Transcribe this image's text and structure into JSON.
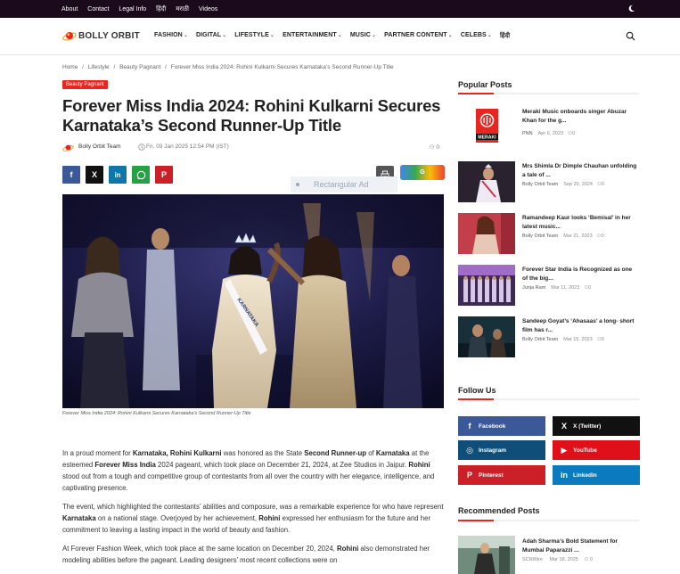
{
  "topbar": {
    "links": [
      "About",
      "Contact",
      "Legal Info",
      "हिंदी",
      "मराठी",
      "Videos"
    ],
    "dark_mode_icon": "moon-icon"
  },
  "header": {
    "logo_text": "BOLLY ORBIT",
    "nav": [
      {
        "label": "FASHION",
        "dropdown": true
      },
      {
        "label": "DIGITAL",
        "dropdown": true
      },
      {
        "label": "LIFESTYLE",
        "dropdown": true
      },
      {
        "label": "ENTERTAINMENT",
        "dropdown": true
      },
      {
        "label": "MUSIC",
        "dropdown": true
      },
      {
        "label": "PARTNER CONTENT",
        "dropdown": true
      },
      {
        "label": "CELEBS",
        "dropdown": true
      },
      {
        "label": "हिंदी",
        "dropdown": false
      }
    ],
    "search_icon": "search-icon"
  },
  "breadcrumb": [
    "Home",
    "/",
    "Lifestyle",
    "/",
    "Beauty Pagnant",
    "/",
    "Forever Miss India 2024: Rohini Kulkarni Secures Karnataka’s Second Runner-Up Title"
  ],
  "article": {
    "category": "Beauty Pagnant",
    "title": "Forever Miss India 2024: Rohini Kulkarni Secures Karnataka’s Second Runner-Up Title",
    "author": "Bolly Orbit Team",
    "date": "Fri, 03 Jan 2025 12:54 PM (IST)",
    "comments": "0",
    "ad_label": "Rectangular Ad",
    "google_badge": "G",
    "caption": "Forever Miss India 2024: Rohini Kulkarni Secures Karnataka's Second Runner-Up Title",
    "paragraphs": [
      [
        {
          "t": "In a proud moment for "
        },
        {
          "t": "Karnataka, Rohini Kulkarni",
          "b": true
        },
        {
          "t": " was honored as the State "
        },
        {
          "t": "Second Runner-up",
          "b": true
        },
        {
          "t": " of "
        },
        {
          "t": "Karnataka",
          "b": true
        },
        {
          "t": " at the esteemed "
        },
        {
          "t": "Forever Miss India",
          "b": true
        },
        {
          "t": " 2024 pageant, which took place on December 21, 2024, at Zee Studios in Jaipur. "
        },
        {
          "t": "Rohini",
          "b": true
        },
        {
          "t": " stood out from a tough and competitive group of contestants from all over the country with her elegance, intelligence, and captivating presence."
        }
      ],
      [
        {
          "t": "The event, which highlighted the contestants’ abilities and composure, was a remarkable experience for who have represent "
        },
        {
          "t": "Karnataka",
          "b": true
        },
        {
          "t": " on a national stage. Overjoyed by her achievement, "
        },
        {
          "t": "Rohini",
          "b": true
        },
        {
          "t": " expressed her enthusiasm for the future and her commitment to leaving a lasting impact in the world of beauty and fashion."
        }
      ],
      [
        {
          "t": "At Forever Fashion Week, which took place at the same location on December 20, 2024, "
        },
        {
          "t": "Rohini",
          "b": true
        },
        {
          "t": " also demonstrated her modeling abilities before the pageant. Leading designers’ most recent collections were on"
        }
      ]
    ]
  },
  "sidebar": {
    "popular_heading": "Popular Posts",
    "popular": [
      {
        "title": "Meraki Music onboards singer Abuzar Khan for the g...",
        "author": "PNN",
        "date": "Apr 6, 2023",
        "comments": "0",
        "thumb": "meraki"
      },
      {
        "title": "Mrs Shimla Dr Dimple Chauhan unfolding a tale of ...",
        "author": "Bolly Orbit Team",
        "date": "Sep 20, 2024",
        "comments": "0",
        "thumb": "shimla"
      },
      {
        "title": "Ramandeep Kaur looks ‘Bemisal’ in her latest music...",
        "author": "Bolly Orbit Team",
        "date": "Mar 21, 2023",
        "comments": "0",
        "thumb": "ramandeep"
      },
      {
        "title": "Forever Star India is Recognized as one of the big...",
        "author": "Junja Ram",
        "date": "Mar 11, 2023",
        "comments": "0",
        "thumb": "forever"
      },
      {
        "title": "Sandeep Goyat’s ‘Ahasaas’ a long- short film has r...",
        "author": "Bolly Orbit Team",
        "date": "Mar 15, 2023",
        "comments": "0",
        "thumb": "sandeep"
      }
    ],
    "meraki_logo_text": "MERAKI",
    "follow_heading": "Follow Us",
    "follow": [
      {
        "label": "Facebook",
        "icon": "facebook-icon",
        "glyph": "f",
        "color": "#3b5998"
      },
      {
        "label": "X (Twitter)",
        "icon": "x-icon",
        "glyph": "X",
        "color": "#111111"
      },
      {
        "label": "Instagram",
        "icon": "instagram-icon",
        "glyph": "◎",
        "color": "#0e4e78"
      },
      {
        "label": "YouTube",
        "icon": "youtube-icon",
        "glyph": "▶",
        "color": "#e0101a"
      },
      {
        "label": "Pinterest",
        "icon": "pinterest-icon",
        "glyph": "P",
        "color": "#cb2027"
      },
      {
        "label": "Linkedin",
        "icon": "linkedin-icon",
        "glyph": "in",
        "color": "#0a7bbf"
      }
    ],
    "recommended_heading": "Recommended Posts",
    "recommended": [
      {
        "title": "Adah Sharma’s Bold Statement for Mumbai Paparazzi ...",
        "author": "SCNWire",
        "date": "Mar 18, 2025",
        "comments": "0"
      }
    ]
  },
  "colors": {
    "accent": "#e8251f",
    "topbar": "#1a0a1c"
  }
}
